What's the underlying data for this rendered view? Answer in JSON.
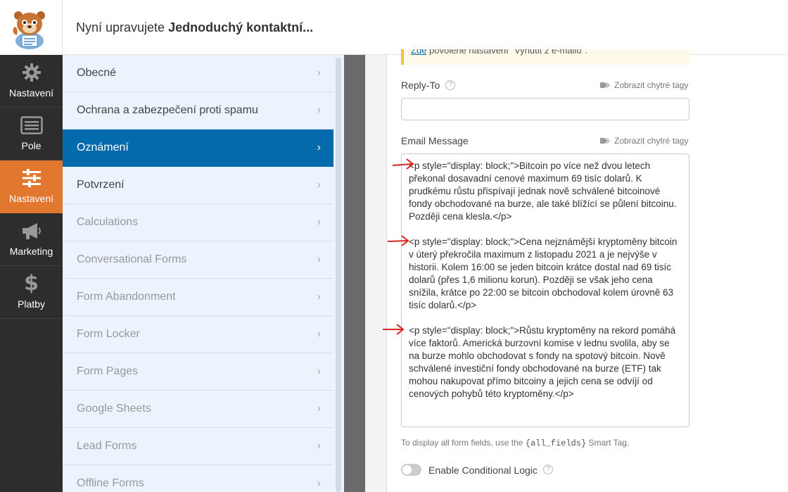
{
  "header": {
    "title_prefix": "Nyní upravujete ",
    "title_form": "Jednoduchý kontaktní..."
  },
  "leftnav": {
    "items": [
      {
        "label": "Nastavení",
        "icon": "gear-icon"
      },
      {
        "label": "Pole",
        "icon": "fields-icon"
      },
      {
        "label": "Nastavení",
        "icon": "sliders-icon",
        "active": true
      },
      {
        "label": "Marketing",
        "icon": "megaphone-icon"
      },
      {
        "label": "Platby",
        "icon": "dollar-icon"
      }
    ]
  },
  "settings": {
    "items": [
      {
        "label": "Obecné"
      },
      {
        "label": "Ochrana a zabezpečení proti spamu"
      },
      {
        "label": "Oznámení",
        "active": true
      },
      {
        "label": "Potvrzení"
      },
      {
        "label": "Calculations"
      },
      {
        "label": "Conversational Forms"
      },
      {
        "label": "Form Abandonment"
      },
      {
        "label": "Form Locker"
      },
      {
        "label": "Form Pages"
      },
      {
        "label": "Google Sheets"
      },
      {
        "label": "Lead Forms"
      },
      {
        "label": "Offline Forms"
      }
    ]
  },
  "notice": {
    "link": "Zde",
    "text": " povolené nastavení \"Vynutit z e-mailu\"."
  },
  "reply_to": {
    "label": "Reply-To",
    "smart_tags": "Zobrazit chytré tagy",
    "value": ""
  },
  "email_message": {
    "label": "Email Message",
    "smart_tags": "Zobrazit chytré tagy",
    "paragraphs": [
      "<p style=\"display: block;\">Bitcoin po více než dvou letech překonal dosavadní cenové maximum 69 tisíc dolarů. K prudkému růstu přispívají jednak nově schválené bitcoinové fondy obchodované na burze, ale také blížící se půlení bitcoinu. Později cena klesla.</p>",
      "<p style=\"display: block;\">Cena nejznámější kryptoměny bitcoin v úterý překročila maximum z listopadu 2021 a je nejvýše v historii. Kolem 16:00 se jeden bitcoin krátce dostal nad 69 tisíc dolarů (přes 1,6 milionu korun). Později se však jeho cena snížila, krátce po 22:00 se bitcoin obchodoval kolem úrovně 63 tisíc dolarů.</p>",
      "<p style=\"display: block;\">Růstu kryptoměny na rekord pomáhá více faktorů. Americká burzovní komise v lednu svolila, aby se na burze mohlo obchodovat s fondy na spotový bitcoin. Nově schválené investiční fondy obchodované na burze (ETF) tak mohou nakupovat přímo bitcoiny a jejich cena se odvíjí od cenových pohybů této kryptoměny.</p>"
    ]
  },
  "hint": {
    "before": "To display all form fields, use the ",
    "code": "{all_fields}",
    "after": " Smart Tag."
  },
  "conditional_logic": {
    "label": "Enable Conditional Logic",
    "enabled": false
  },
  "colors": {
    "accent_orange": "#e27730",
    "active_blue": "#036aab",
    "arrow_red": "#d9251c"
  }
}
